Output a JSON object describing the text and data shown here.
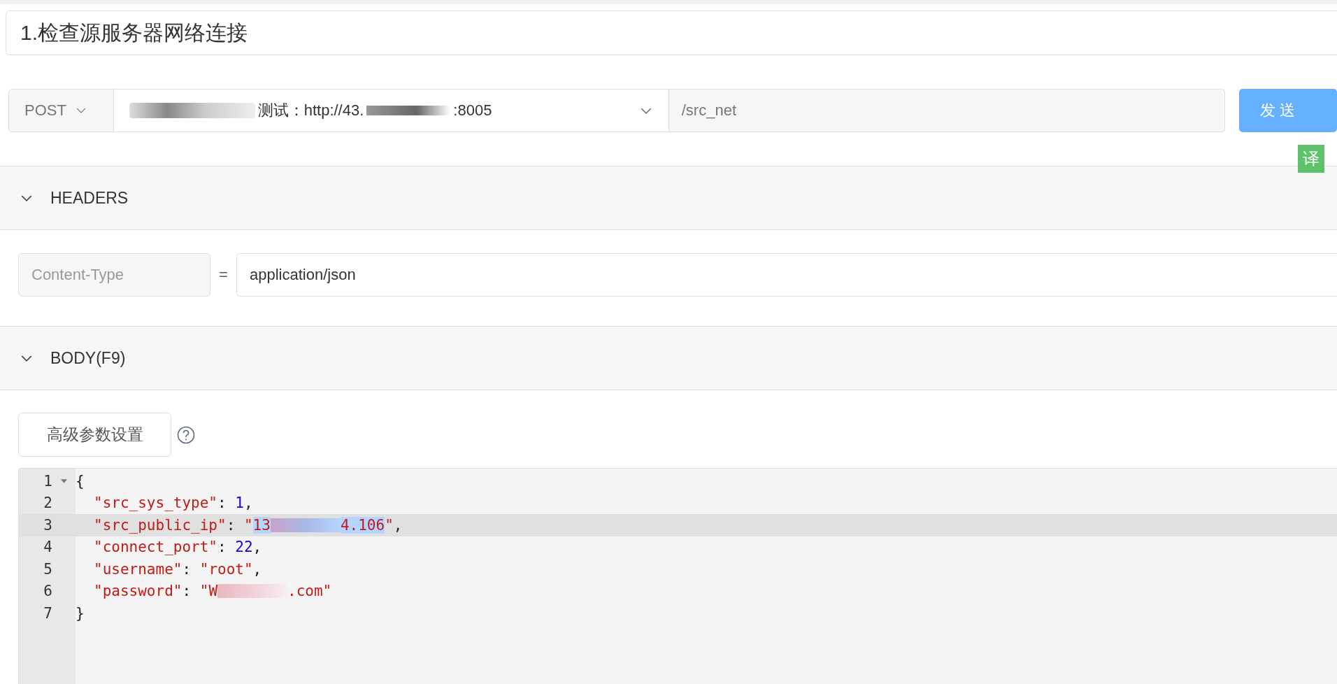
{
  "title_field": {
    "value": "1.检查源服务器网络连接"
  },
  "request": {
    "method": "POST",
    "server_prefix": "测试：http://43.",
    "server_suffix": ":8005",
    "path": "/src_net",
    "send_label": "发 送"
  },
  "translate_badge": "译",
  "sections": [
    {
      "label": "HEADERS",
      "expanded": true
    },
    {
      "label": "BODY(F9)",
      "expanded": true
    }
  ],
  "headers": [
    {
      "key": "Content-Type",
      "separator": "=",
      "value": "application/json"
    }
  ],
  "advanced_button": "高级参数设置",
  "editor": {
    "lines": [
      {
        "number": "1",
        "selected": false,
        "foldable": true,
        "indented": false,
        "tokens": [
          {
            "kind": "punct",
            "text": "{"
          }
        ]
      },
      {
        "number": "2",
        "selected": false,
        "foldable": false,
        "indented": true,
        "tokens": [
          {
            "kind": "string",
            "text": "\"src_sys_type\""
          },
          {
            "kind": "punct",
            "text": ": "
          },
          {
            "kind": "number",
            "text": "1"
          },
          {
            "kind": "punct",
            "text": ","
          }
        ]
      },
      {
        "number": "3",
        "selected": true,
        "foldable": false,
        "indented": true,
        "tokens": [
          {
            "kind": "string",
            "text": "\"src_public_ip\""
          },
          {
            "kind": "punct",
            "text": ": "
          },
          {
            "kind": "string",
            "text": "\""
          },
          {
            "kind": "selected-string",
            "text": "13"
          },
          {
            "kind": "redacted"
          },
          {
            "kind": "selected-string",
            "text": "4.106"
          },
          {
            "kind": "string",
            "text": "\""
          },
          {
            "kind": "punct",
            "text": ","
          }
        ]
      },
      {
        "number": "4",
        "selected": false,
        "foldable": false,
        "indented": true,
        "tokens": [
          {
            "kind": "string",
            "text": "\"connect_port\""
          },
          {
            "kind": "punct",
            "text": ": "
          },
          {
            "kind": "number",
            "text": "22"
          },
          {
            "kind": "punct",
            "text": ","
          }
        ]
      },
      {
        "number": "5",
        "selected": false,
        "foldable": false,
        "indented": true,
        "tokens": [
          {
            "kind": "string",
            "text": "\"username\""
          },
          {
            "kind": "punct",
            "text": ": "
          },
          {
            "kind": "string",
            "text": "\"root\""
          },
          {
            "kind": "punct",
            "text": ","
          }
        ]
      },
      {
        "number": "6",
        "selected": false,
        "foldable": false,
        "indented": true,
        "tokens": [
          {
            "kind": "string",
            "text": "\"password\""
          },
          {
            "kind": "punct",
            "text": ": "
          },
          {
            "kind": "string",
            "text": "\"W"
          },
          {
            "kind": "redacted"
          },
          {
            "kind": "string",
            "text": ".com\""
          }
        ]
      },
      {
        "number": "7",
        "selected": false,
        "foldable": false,
        "indented": false,
        "tokens": [
          {
            "kind": "punct",
            "text": "}"
          }
        ]
      }
    ]
  }
}
